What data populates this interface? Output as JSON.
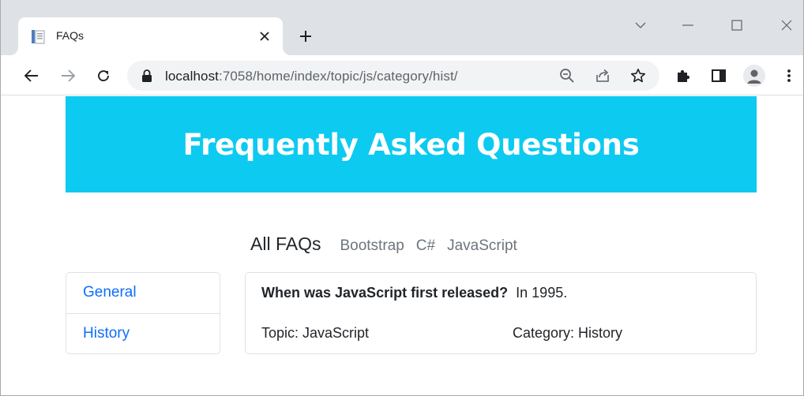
{
  "browser": {
    "tab_title": "FAQs",
    "url_host": "localhost",
    "url_path": ":7058/home/index/topic/js/category/hist/"
  },
  "icons": {
    "tab_favicon": "document-favicon-icon",
    "tab_close": "close-icon",
    "new_tab": "plus-icon",
    "tab_search": "chevron-down-icon",
    "minimize": "minimize-icon",
    "maximize": "maximize-icon",
    "close_window": "close-icon",
    "back": "arrow-left-icon",
    "forward": "arrow-right-icon",
    "reload": "reload-icon",
    "lock": "lock-icon",
    "zoom": "zoom-out-icon",
    "share": "share-icon",
    "bookmark": "star-icon",
    "extensions": "puzzle-icon",
    "side_panel": "side-panel-icon",
    "profile": "person-icon",
    "menu": "kebab-menu-icon"
  },
  "colors": {
    "banner_bg": "#0dcaf0",
    "link": "#0d6efd",
    "muted_link": "#6c757d",
    "chrome_bg": "#dee1e6"
  },
  "header": {
    "title": "Frequently Asked Questions"
  },
  "topics": {
    "all_label": "All FAQs",
    "items": [
      {
        "label": "Bootstrap"
      },
      {
        "label": "C#"
      },
      {
        "label": "JavaScript"
      }
    ]
  },
  "categories": {
    "items": [
      {
        "label": "General"
      },
      {
        "label": "History"
      }
    ]
  },
  "faq": {
    "question": "When was JavaScript first released?",
    "answer": "In 1995.",
    "topic": "Topic: JavaScript",
    "category": "Category: History"
  }
}
